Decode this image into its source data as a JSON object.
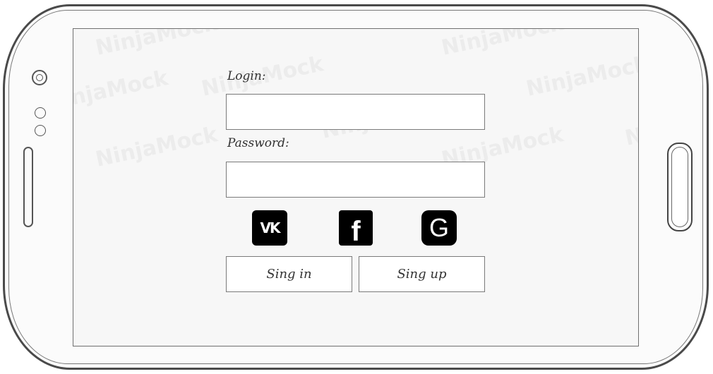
{
  "watermark": {
    "text": "NinjaMock"
  },
  "login_form": {
    "login_label": "Login:",
    "login_value": "",
    "password_label": "Password:",
    "password_value": ""
  },
  "social": {
    "vk": {
      "label": "VK",
      "icon": "vk-icon"
    },
    "facebook": {
      "label": "f",
      "icon": "facebook-icon"
    },
    "google": {
      "label": "G",
      "icon": "google-icon"
    }
  },
  "buttons": {
    "sign_in": "Sing in",
    "sign_up": "Sing up"
  },
  "colors": {
    "social_bg": "#000000",
    "border": "#7a7a7a",
    "background": "#f7f7f7"
  }
}
